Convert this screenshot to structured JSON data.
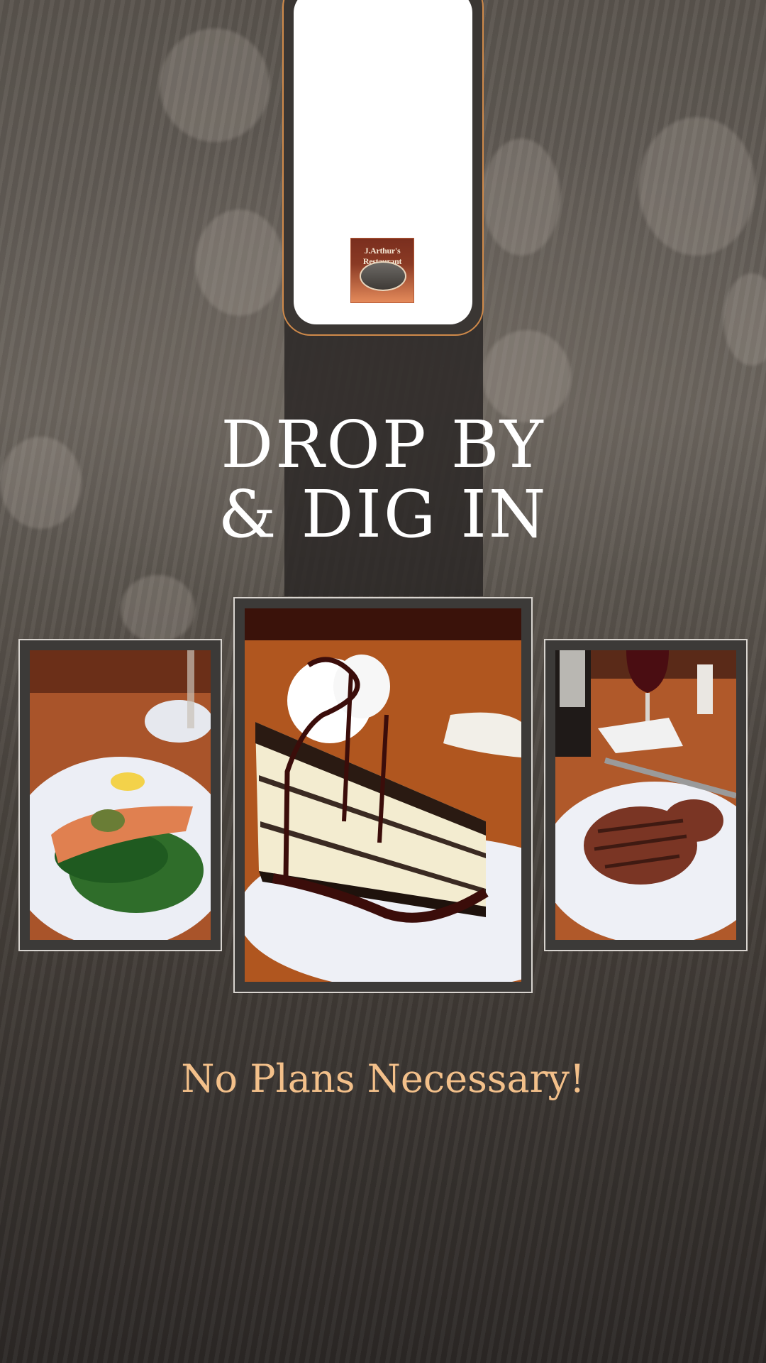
{
  "logo": {
    "text": "J.Arthur's Restaurant",
    "accent_color": "#d08a4a"
  },
  "headline": {
    "line1": "DROP BY",
    "line2": "& DIG IN"
  },
  "photos": [
    {
      "subject": "salmon-with-spinach"
    },
    {
      "subject": "chocolate-cheesecake"
    },
    {
      "subject": "grilled-steak"
    }
  ],
  "tagline": {
    "text": "No Plans Necessary!",
    "color": "#f3c08a"
  }
}
